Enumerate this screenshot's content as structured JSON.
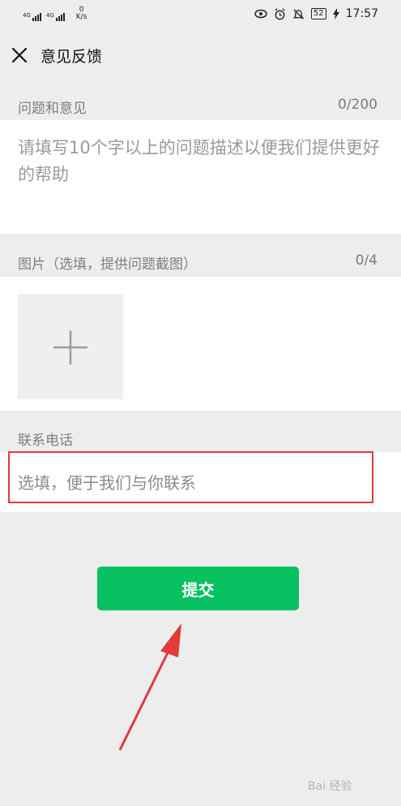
{
  "status_bar": {
    "net1": "4G",
    "net2": "4G",
    "speed_value": "0",
    "speed_unit": "K/s",
    "battery": "52",
    "time": "17:57"
  },
  "header": {
    "title": "意见反馈"
  },
  "feedback": {
    "label": "问题和意见",
    "count": "0/200",
    "placeholder": "请填写10个字以上的问题描述以便我们提供更好的帮助"
  },
  "images": {
    "label": "图片（选填，提供问题截图）",
    "count": "0/4"
  },
  "contact": {
    "label": "联系电话",
    "placeholder": "选填，便于我们与你联系"
  },
  "submit_label": "提交",
  "watermark": "Bai 经验",
  "colors": {
    "accent": "#07c160",
    "annotation": "#e33a3a"
  }
}
